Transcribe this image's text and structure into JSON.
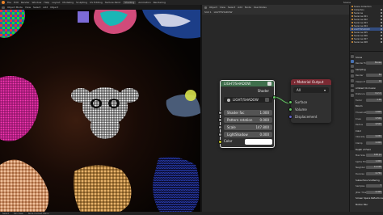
{
  "menubar": {
    "items": [
      "File",
      "Edit",
      "Render",
      "Window",
      "Help"
    ],
    "workspaces": [
      "Layout",
      "Modeling",
      "Sculpting",
      "UV Editing",
      "Texture Paint",
      "Shading",
      "Animation",
      "Rendering"
    ],
    "active_workspace": "Shading",
    "scene": "Scene"
  },
  "viewport": {
    "mode": "Object Mode",
    "menus": [
      "View",
      "Select",
      "Add",
      "Object"
    ]
  },
  "node_editor": {
    "header_row1": [
      "Object",
      "View",
      "Select",
      "Add",
      "Node",
      "Use Nodes"
    ],
    "header_row2": [
      "LIGHTSHADOW"
    ],
    "slot": "Slot 1",
    "material": "LIGHTSHADOW",
    "group_node": {
      "title": "LIGHT/SHADOW",
      "output_label": "Shader",
      "group_name": "LIGHT/SHADOW",
      "fields": [
        {
          "label": "Shader fac",
          "value": "1.000"
        },
        {
          "label": "Pattern rotation",
          "value": "0.000"
        },
        {
          "label": "Scale",
          "value": "147.800"
        },
        {
          "label": "LightShadow",
          "value": "0.000"
        }
      ],
      "color_label": "Color"
    },
    "output_node": {
      "title": "Material Output",
      "target": "All",
      "inputs": [
        "Surface",
        "Volume",
        "Displacement"
      ]
    }
  },
  "properties": {
    "outliner_rows": [
      "Scene Collection",
      "Collection",
      "Suzanne",
      "Suzanne.001",
      "Suzanne.002",
      "Suzanne.003",
      "Suzanne.004",
      "LIGHTSHADOW",
      "Suzanne.005",
      "Suzanne.006",
      "Suzanne.007",
      "Suzanne.008"
    ],
    "rows": [
      {
        "label": "Scene",
        "value": ""
      },
      {
        "label": "Render Engine",
        "value": "Eevee"
      },
      {
        "label": "Sampling",
        "value": ""
      },
      {
        "label": "Render",
        "value": "64"
      },
      {
        "label": "Viewport",
        "value": "16"
      },
      {
        "label": "Ambient Occlusion",
        "value": ""
      },
      {
        "label": "Distance",
        "value": "0.2 m"
      },
      {
        "label": "Factor",
        "value": "1.00"
      },
      {
        "label": "Bloom",
        "value": ""
      },
      {
        "label": "Threshold",
        "value": "0.800"
      },
      {
        "label": "Knee",
        "value": "0.500"
      },
      {
        "label": "Radius",
        "value": "6.500"
      },
      {
        "label": "Color",
        "value": ""
      },
      {
        "label": "Intensity",
        "value": "0.050"
      },
      {
        "label": "Clamp",
        "value": "0.000"
      },
      {
        "label": "Depth of Field",
        "value": ""
      },
      {
        "label": "Max Size",
        "value": "100 px"
      },
      {
        "label": "Sprite Threshold",
        "value": "1.000"
      },
      {
        "label": "Neighbor Rejection",
        "value": "10.000"
      },
      {
        "label": "Denoise",
        "value": "0.750"
      },
      {
        "label": "Subsurface Scattering",
        "value": ""
      },
      {
        "label": "Samples",
        "value": "7"
      },
      {
        "label": "Jitter Threshold",
        "value": "0.300"
      },
      {
        "label": "Screen Space Reflections",
        "value": ""
      },
      {
        "label": "Motion Blur",
        "value": ""
      }
    ]
  },
  "status": {
    "left": "Select",
    "middle": "Pan View",
    "right": "Node Context Menu"
  },
  "colors": {
    "group_header": "#3f6f4c",
    "output_header": "#7a2a33",
    "shader_socket": "#63c763",
    "float_socket": "#a1a1a1",
    "color_socket": "#c7c729",
    "vector_socket": "#6363c7",
    "link": "#63c763"
  }
}
